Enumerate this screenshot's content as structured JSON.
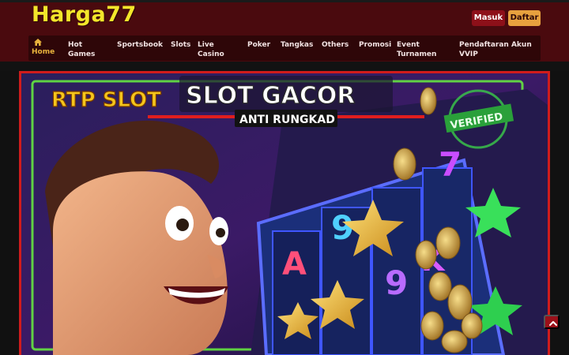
{
  "brand": {
    "logo_text": "Harga77"
  },
  "header": {
    "login_label": "Masuk",
    "register_label": "Daftar"
  },
  "nav": {
    "items": [
      {
        "id": "home",
        "label": "Home",
        "icon": "home-icon",
        "active": true
      },
      {
        "id": "hot-games",
        "label": "Hot Games"
      },
      {
        "id": "sportsbook",
        "label": "Sportsbook"
      },
      {
        "id": "slots",
        "label": "Slots"
      },
      {
        "id": "live-casino",
        "label": "Live Casino"
      },
      {
        "id": "poker",
        "label": "Poker"
      },
      {
        "id": "tangkas",
        "label": "Tangkas"
      },
      {
        "id": "others",
        "label": "Others"
      },
      {
        "id": "promosi",
        "label": "Promosi"
      },
      {
        "id": "event-turnamen",
        "label": "Event Turnamen"
      },
      {
        "id": "pendaftaran-akun-vvip",
        "label": "Pendaftaran Akun VVIP"
      }
    ]
  },
  "banner": {
    "title": "SLOT GACOR",
    "subtitle": "ANTI RUNGKAD",
    "badge_rtp": "RTP SLOT",
    "badge_verified": "VERIFIED",
    "reel_symbols": [
      "A",
      "9",
      "9",
      "K",
      "7"
    ]
  },
  "colors": {
    "header_bg": "#4a0a0e",
    "nav_bg": "#2e0608",
    "accent_gold": "#e9b33c",
    "logo_yellow": "#f3e62a",
    "banner_border": "#d01c1c"
  },
  "scroll_top": {
    "icon": "chevron-up-icon"
  }
}
